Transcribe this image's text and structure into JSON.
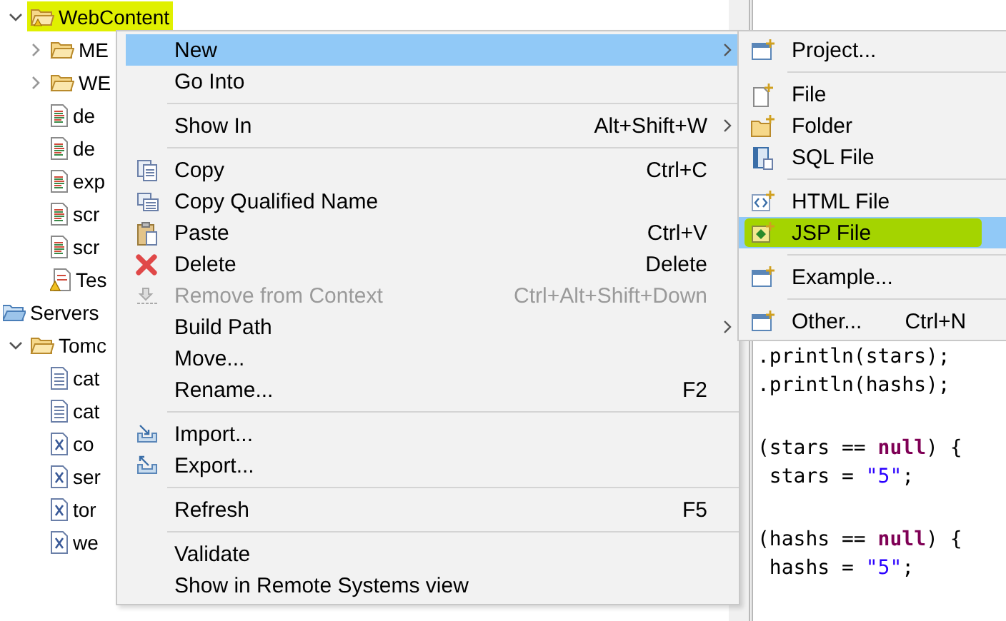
{
  "tree": [
    {
      "label": "WebContent",
      "kind": "folder",
      "expanded": true,
      "highlighted": true,
      "children": [
        {
          "label": "ME",
          "kind": "folder",
          "expanded": false,
          "highlighted": false
        },
        {
          "label": "WE",
          "kind": "folder",
          "expanded": false,
          "highlighted": false
        },
        {
          "label": "de",
          "kind": "web-file",
          "highlighted": false
        },
        {
          "label": "de",
          "kind": "web-file",
          "highlighted": false
        },
        {
          "label": "exp",
          "kind": "web-file",
          "highlighted": false
        },
        {
          "label": "scr",
          "kind": "web-file",
          "highlighted": false
        },
        {
          "label": "scr",
          "kind": "web-file",
          "highlighted": false
        },
        {
          "label": "Tes",
          "kind": "warning-file",
          "highlighted": false
        }
      ]
    },
    {
      "label": "Servers",
      "kind": "project",
      "highlighted": false
    },
    {
      "label": "Tomc",
      "kind": "folder",
      "expanded": true,
      "highlighted": false,
      "children": [
        {
          "label": "cat",
          "kind": "text-file",
          "highlighted": false
        },
        {
          "label": "cat",
          "kind": "text-file",
          "highlighted": false
        },
        {
          "label": "co",
          "kind": "xml-file",
          "highlighted": false
        },
        {
          "label": "ser",
          "kind": "xml-file",
          "highlighted": false
        },
        {
          "label": "tor",
          "kind": "xml-file",
          "highlighted": false
        },
        {
          "label": "we",
          "kind": "xml-file",
          "highlighted": false
        }
      ]
    }
  ],
  "context_menu": {
    "groups": [
      [
        {
          "label": "New",
          "kind": "plain",
          "submenu": true,
          "selected": true,
          "disabled": false
        },
        {
          "label": "Go Into",
          "kind": "plain",
          "selected": false,
          "disabled": false
        }
      ],
      [
        {
          "label": "Show In",
          "kind": "plain",
          "shortcut": "Alt+Shift+W",
          "submenu": true,
          "selected": false,
          "disabled": false
        }
      ],
      [
        {
          "label": "Copy",
          "kind": "copy",
          "shortcut": "Ctrl+C",
          "selected": false,
          "disabled": false
        },
        {
          "label": "Copy Qualified Name",
          "kind": "copy-name",
          "selected": false,
          "disabled": false
        },
        {
          "label": "Paste",
          "kind": "paste",
          "shortcut": "Ctrl+V",
          "selected": false,
          "disabled": false
        },
        {
          "label": "Delete",
          "kind": "delete",
          "shortcut": "Delete",
          "selected": false,
          "disabled": false
        },
        {
          "label": "Remove from Context",
          "kind": "remove",
          "shortcut": "Ctrl+Alt+Shift+Down",
          "selected": false,
          "disabled": true
        },
        {
          "label": "Build Path",
          "kind": "plain",
          "submenu": true,
          "selected": false,
          "disabled": false
        },
        {
          "label": "Move...",
          "kind": "plain",
          "selected": false,
          "disabled": false
        },
        {
          "label": "Rename...",
          "kind": "plain",
          "shortcut": "F2",
          "selected": false,
          "disabled": false
        }
      ],
      [
        {
          "label": "Import...",
          "kind": "import",
          "selected": false,
          "disabled": false
        },
        {
          "label": "Export...",
          "kind": "export",
          "selected": false,
          "disabled": false
        }
      ],
      [
        {
          "label": "Refresh",
          "kind": "plain",
          "shortcut": "F5",
          "selected": false,
          "disabled": false
        }
      ],
      [
        {
          "label": "Validate",
          "kind": "plain",
          "selected": false,
          "disabled": false
        },
        {
          "label": "Show in Remote Systems view",
          "kind": "plain",
          "selected": false,
          "disabled": false
        }
      ]
    ]
  },
  "submenu": {
    "groups": [
      [
        {
          "label": "Project...",
          "kind": "project",
          "selected": false,
          "highlighted": false
        }
      ],
      [
        {
          "label": "File",
          "kind": "file",
          "selected": false,
          "highlighted": false
        },
        {
          "label": "Folder",
          "kind": "folder",
          "selected": false,
          "highlighted": false
        },
        {
          "label": "SQL File",
          "kind": "sql",
          "selected": false,
          "highlighted": false
        }
      ],
      [
        {
          "label": "HTML File",
          "kind": "html",
          "selected": false,
          "highlighted": false
        },
        {
          "label": "JSP File",
          "kind": "jsp",
          "selected": true,
          "highlighted": true
        }
      ],
      [
        {
          "label": "Example...",
          "kind": "wizard",
          "selected": false,
          "highlighted": false
        }
      ],
      [
        {
          "label": "Other...",
          "kind": "wizard",
          "shortcut": "Ctrl+N",
          "selected": false,
          "highlighted": false
        }
      ]
    ]
  },
  "code": {
    "blocks": [
      [
        [
          {
            "kind": "text",
            "text": ".println(stars);"
          }
        ],
        [
          {
            "kind": "text",
            "text": ".println(hashs);"
          }
        ]
      ],
      [
        [
          {
            "kind": "text",
            "text": "(stars == "
          },
          {
            "kind": "keyword",
            "text": "null"
          },
          {
            "kind": "text",
            "text": ") {"
          }
        ],
        [
          {
            "kind": "text",
            "text": " stars = "
          },
          {
            "kind": "string",
            "text": "\"5\""
          },
          {
            "kind": "text",
            "text": ";"
          }
        ]
      ],
      [
        [
          {
            "kind": "text",
            "text": "(hashs == "
          },
          {
            "kind": "keyword",
            "text": "null"
          },
          {
            "kind": "text",
            "text": ") {"
          }
        ],
        [
          {
            "kind": "text",
            "text": " hashs = "
          },
          {
            "kind": "string",
            "text": "\"5\""
          },
          {
            "kind": "text",
            "text": ";"
          }
        ]
      ]
    ]
  }
}
